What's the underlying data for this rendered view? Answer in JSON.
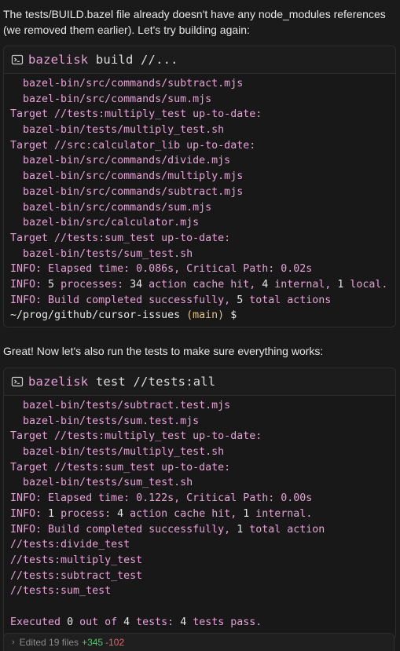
{
  "intro_text": "The tests/BUILD.bazel file already doesn't have any node_modules references (we removed them earlier). Let's try building again:",
  "terminal1": {
    "command_name": "bazelisk",
    "command_args": "build //...",
    "lines": [
      {
        "segments": [
          {
            "t": "  bazel-bin/src/commands/subtract.mjs",
            "c": "pink"
          }
        ]
      },
      {
        "segments": [
          {
            "t": "  bazel-bin/src/commands/sum.mjs",
            "c": "pink"
          }
        ]
      },
      {
        "segments": [
          {
            "t": "Target //tests:multiply_test up-to-date:",
            "c": "pink"
          }
        ]
      },
      {
        "segments": [
          {
            "t": "  bazel-bin/tests/multiply_test.sh",
            "c": "pink"
          }
        ]
      },
      {
        "segments": [
          {
            "t": "Target //src:calculator_lib up-to-date:",
            "c": "pink"
          }
        ]
      },
      {
        "segments": [
          {
            "t": "  bazel-bin/src/commands/divide.mjs",
            "c": "pink"
          }
        ]
      },
      {
        "segments": [
          {
            "t": "  bazel-bin/src/commands/multiply.mjs",
            "c": "pink"
          }
        ]
      },
      {
        "segments": [
          {
            "t": "  bazel-bin/src/commands/subtract.mjs",
            "c": "pink"
          }
        ]
      },
      {
        "segments": [
          {
            "t": "  bazel-bin/src/commands/sum.mjs",
            "c": "pink"
          }
        ]
      },
      {
        "segments": [
          {
            "t": "  bazel-bin/src/calculator.mjs",
            "c": "pink"
          }
        ]
      },
      {
        "segments": [
          {
            "t": "Target //tests:sum_test up-to-date:",
            "c": "pink"
          }
        ]
      },
      {
        "segments": [
          {
            "t": "  bazel-bin/tests/sum_test.sh",
            "c": "pink"
          }
        ]
      },
      {
        "segments": [
          {
            "t": "INFO: Elapsed time: 0.086s, Critical Path: 0.02s",
            "c": "pink"
          }
        ]
      },
      {
        "segments": [
          {
            "t": "INFO: ",
            "c": "pink"
          },
          {
            "t": "5",
            "c": "white"
          },
          {
            "t": " processes: ",
            "c": "pink"
          },
          {
            "t": "34",
            "c": "white"
          },
          {
            "t": " action cache hit, ",
            "c": "pink"
          },
          {
            "t": "4",
            "c": "white"
          },
          {
            "t": " internal, ",
            "c": "pink"
          },
          {
            "t": "1",
            "c": "white"
          },
          {
            "t": " local.",
            "c": "pink"
          }
        ]
      },
      {
        "segments": [
          {
            "t": "INFO: Build completed successfully, ",
            "c": "pink"
          },
          {
            "t": "5",
            "c": "white"
          },
          {
            "t": " total actions",
            "c": "pink"
          }
        ]
      },
      {
        "segments": [
          {
            "t": "~/prog/github/cursor-issues ",
            "c": "white"
          },
          {
            "t": "(main)",
            "c": "yellow"
          },
          {
            "t": " $",
            "c": "white"
          }
        ]
      }
    ]
  },
  "middle_text": "Great! Now let's also run the tests to make sure everything works:",
  "terminal2": {
    "command_name": "bazelisk",
    "command_args": "test //tests:all",
    "lines": [
      {
        "segments": [
          {
            "t": "  bazel-bin/tests/subtract.test.mjs",
            "c": "pink"
          }
        ]
      },
      {
        "segments": [
          {
            "t": "  bazel-bin/tests/sum.test.mjs",
            "c": "pink"
          }
        ]
      },
      {
        "segments": [
          {
            "t": "Target //tests:multiply_test up-to-date:",
            "c": "pink"
          }
        ]
      },
      {
        "segments": [
          {
            "t": "  bazel-bin/tests/multiply_test.sh",
            "c": "pink"
          }
        ]
      },
      {
        "segments": [
          {
            "t": "Target //tests:sum_test up-to-date:",
            "c": "pink"
          }
        ]
      },
      {
        "segments": [
          {
            "t": "  bazel-bin/tests/sum_test.sh",
            "c": "pink"
          }
        ]
      },
      {
        "segments": [
          {
            "t": "INFO: Elapsed time: 0.122s, Critical Path: 0.00s",
            "c": "pink"
          }
        ]
      },
      {
        "segments": [
          {
            "t": "INFO: ",
            "c": "pink"
          },
          {
            "t": "1",
            "c": "white"
          },
          {
            "t": " process: ",
            "c": "pink"
          },
          {
            "t": "4",
            "c": "white"
          },
          {
            "t": " action cache hit, ",
            "c": "pink"
          },
          {
            "t": "1",
            "c": "white"
          },
          {
            "t": " internal.",
            "c": "pink"
          }
        ]
      },
      {
        "segments": [
          {
            "t": "INFO: Build completed successfully, ",
            "c": "pink"
          },
          {
            "t": "1",
            "c": "white"
          },
          {
            "t": " total action",
            "c": "pink"
          }
        ]
      },
      {
        "segments": [
          {
            "t": "//tests:divide_test",
            "c": "pink"
          }
        ]
      },
      {
        "segments": [
          {
            "t": "//tests:multiply_test",
            "c": "pink"
          }
        ]
      },
      {
        "segments": [
          {
            "t": "//tests:subtract_test",
            "c": "pink"
          }
        ]
      },
      {
        "segments": [
          {
            "t": "//tests:sum_test",
            "c": "pink"
          }
        ]
      },
      {
        "segments": [
          {
            "t": "",
            "c": "pink"
          }
        ]
      },
      {
        "segments": [
          {
            "t": "Executed ",
            "c": "pink"
          },
          {
            "t": "0",
            "c": "white"
          },
          {
            "t": " out of ",
            "c": "pink"
          },
          {
            "t": "4",
            "c": "white"
          },
          {
            "t": " tests: ",
            "c": "pink"
          },
          {
            "t": "4",
            "c": "white"
          },
          {
            "t": " tests pass.",
            "c": "pink"
          }
        ]
      }
    ]
  },
  "footer": {
    "label": "Edited 19 files",
    "additions": "+345",
    "deletions": "-102"
  },
  "colors": {
    "accent_pink": "#e8a0d8",
    "text_white": "#e6e6e6",
    "branch_yellow": "#e5c07b",
    "add_green": "#56c46e",
    "del_red": "#e06c6c"
  },
  "icons": {
    "terminal_icon": "terminal-icon",
    "footer_chevron": "chevron-right-icon"
  }
}
